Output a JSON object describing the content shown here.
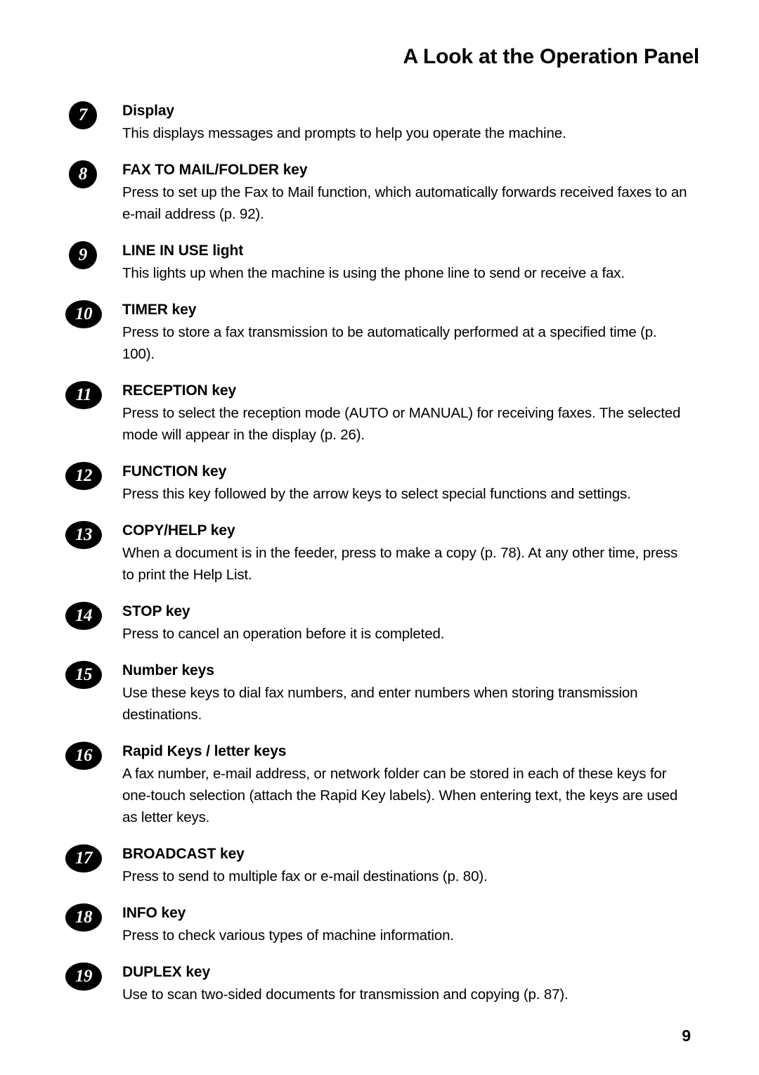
{
  "header": {
    "title": "A Look at the Operation Panel"
  },
  "footer": {
    "page_number": "9"
  },
  "entries": [
    {
      "number": "7",
      "title": "Display",
      "body": "This displays messages and prompts to help you operate the machine."
    },
    {
      "number": "8",
      "title": "FAX TO MAIL/FOLDER key",
      "body": "Press to set up the Fax to Mail function, which automatically forwards received faxes to an e-mail address (p. 92)."
    },
    {
      "number": "9",
      "title": "LINE IN USE light",
      "body": "This lights up when the machine is using the phone line to send or receive a fax."
    },
    {
      "number": "10",
      "title": "TIMER key",
      "body": "Press to store a fax transmission to be automatically performed at a specified time (p. 100)."
    },
    {
      "number": "11",
      "title": "RECEPTION key",
      "body": "Press to select the reception mode (AUTO or MANUAL) for receiving faxes. The selected mode will appear in the display (p. 26)."
    },
    {
      "number": "12",
      "title": "FUNCTION key",
      "body": "Press this key followed by the arrow keys to select special functions and settings."
    },
    {
      "number": "13",
      "title": "COPY/HELP key",
      "body": "When a document is in the feeder, press to make a copy (p. 78). At any other time, press to print the Help List."
    },
    {
      "number": "14",
      "title": "STOP key",
      "body": "Press to cancel an operation before it is completed."
    },
    {
      "number": "15",
      "title": "Number keys",
      "body": "Use these keys to dial fax numbers, and enter numbers when storing transmission destinations."
    },
    {
      "number": "16",
      "title": "Rapid Keys / letter keys",
      "body": "A fax number, e-mail address, or network folder can be stored in each of these keys for one-touch selection (attach the Rapid Key labels). When entering text, the keys are used as letter keys."
    },
    {
      "number": "17",
      "title": "BROADCAST key",
      "body": "Press to send to multiple fax or e-mail destinations (p. 80)."
    },
    {
      "number": "18",
      "title": "INFO key",
      "body": "Press to check various types of machine information."
    },
    {
      "number": "19",
      "title": "DUPLEX key",
      "body": "Use to scan two-sided documents for transmission and copying (p. 87)."
    }
  ]
}
